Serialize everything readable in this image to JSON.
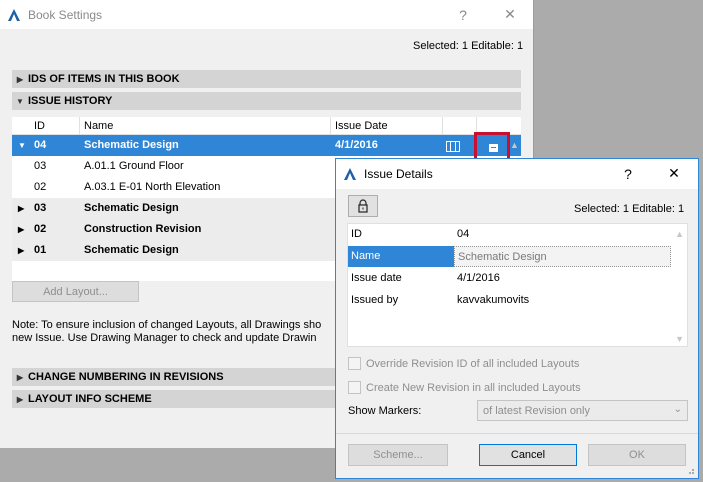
{
  "main_window": {
    "title": "Book Settings",
    "help_label": "?",
    "close_label": "✕",
    "selection_info": "Selected: 1 Editable: 1",
    "sections": {
      "ids": "IDS OF ITEMS IN THIS BOOK",
      "issue_history": "ISSUE HISTORY",
      "change_numbering": "CHANGE NUMBERING IN REVISIONS",
      "layout_info": "LAYOUT INFO SCHEME"
    },
    "table": {
      "headers": [
        "ID",
        "Name",
        "Issue Date"
      ],
      "rows": [
        {
          "id": "04",
          "name": "Schematic Design",
          "date": "4/1/2016"
        },
        {
          "id": "03",
          "name": "A.01.1 Ground Floor",
          "date": ""
        },
        {
          "id": "02",
          "name": "A.03.1 E-01 North Elevation",
          "date": ""
        },
        {
          "id": "03",
          "name": "Schematic Design",
          "date": ""
        },
        {
          "id": "02",
          "name": "Construction Revision",
          "date": ""
        },
        {
          "id": "01",
          "name": "Schematic Design",
          "date": ""
        }
      ]
    },
    "add_layout_button": "Add Layout...",
    "note_line1": "Note: To ensure inclusion of changed Layouts, all Drawings sho",
    "note_line2": "new Issue. Use Drawing Manager to check and update Drawin"
  },
  "dialog": {
    "title": "Issue Details",
    "help_label": "?",
    "close_label": "✕",
    "selection_info": "Selected: 1 Editable: 1",
    "properties": [
      {
        "key": "ID",
        "value": "04"
      },
      {
        "key": "Name",
        "value": "Schematic Design"
      },
      {
        "key": "Issue date",
        "value": "4/1/2016"
      },
      {
        "key": "Issued by",
        "value": "kavvakumovits"
      }
    ],
    "override_checkbox": "Override Revision ID of all included Layouts",
    "create_revision_checkbox": "Create New Revision in all included Layouts",
    "show_markers_label": "Show Markers:",
    "show_markers_value": "of latest Revision only",
    "scheme_button": "Scheme...",
    "cancel_button": "Cancel",
    "ok_button": "OK"
  },
  "colors": {
    "selection": "#2f86d6",
    "highlight_box": "#c8102e",
    "section_bar": "#d4d4d4"
  }
}
